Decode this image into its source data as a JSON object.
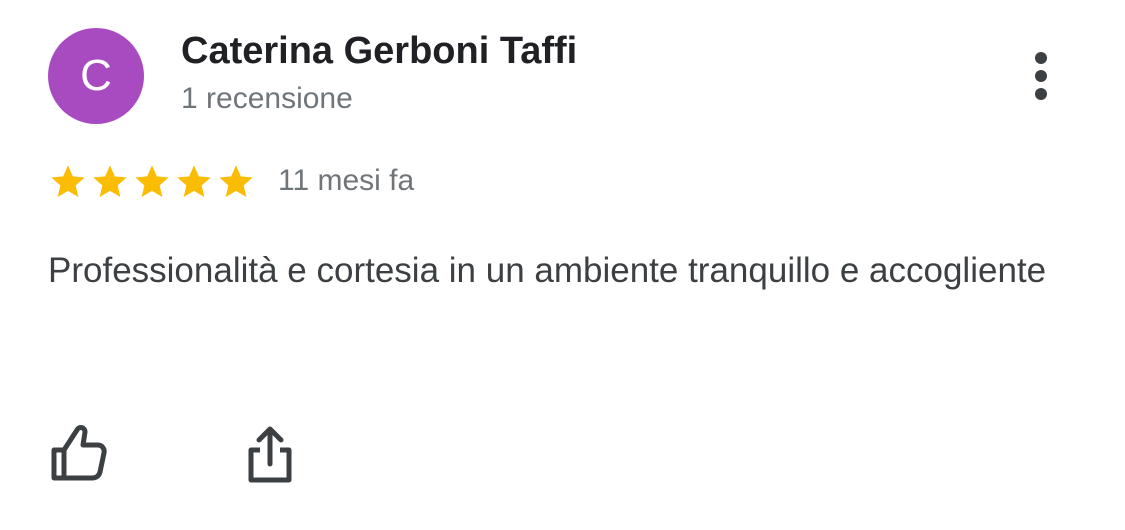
{
  "review": {
    "author": {
      "initial": "C",
      "name": "Caterina Gerboni Taffi",
      "review_count": "1 recensione",
      "avatar_color": "#A84BC1"
    },
    "rating": 5,
    "rating_max": 5,
    "date": "11 mesi fa",
    "text": "Professionalità e cortesia in un ambiente tranquillo e accogliente"
  },
  "colors": {
    "star": "#FBBC04",
    "name": "#202124",
    "secondary": "#70757A",
    "body_text": "#3C4043",
    "icon": "#3C4043"
  },
  "icons": {
    "menu": "more-vert-icon",
    "like": "thumb-up-icon",
    "share": "share-icon"
  }
}
